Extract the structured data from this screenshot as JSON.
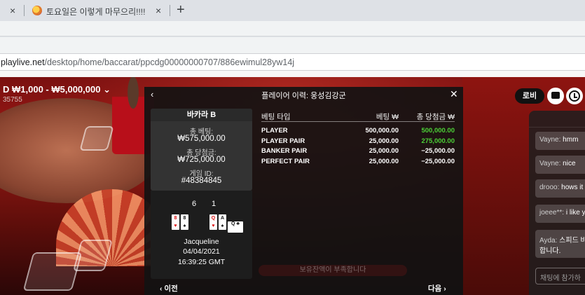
{
  "browser": {
    "tab_title": "토요일은 이렇게 마무으리!!!!",
    "close_glyph": "×",
    "new_tab_glyph": "+",
    "url_domain": "playlive.net",
    "url_path": "/desktop/home/baccarat/ppcdg00000000707/886ewimul28yw14j"
  },
  "game": {
    "title": "D ₩1,000 - ₩5,000,000",
    "subtitle": "35755",
    "lobby_label": "로비",
    "warning": "보유잔액이 부족합니다"
  },
  "chat": {
    "messages": [
      {
        "name": "Vayne:",
        "text": "hmm"
      },
      {
        "name": "Vayne:",
        "text": "nice"
      },
      {
        "name": "drooo:",
        "text": "hows it"
      },
      {
        "name": "joeee**:",
        "text": "i like yo"
      },
      {
        "name": "Ayda:",
        "text": "스피드 바 합니다."
      }
    ],
    "input_placeholder": "채팅에 참가하"
  },
  "history": {
    "title": "플레이어 이력: 웅성김강군",
    "game_name": "바카라 B",
    "total_bet_label": "총 베팅:",
    "total_bet_value": "₩575,000.00",
    "total_win_label": "총 당첨금:",
    "total_win_value": "₩725,000.00",
    "game_id_label": "게임 ID:",
    "game_id_value": "#48384845",
    "player_score": "6",
    "banker_score": "1",
    "cards": {
      "player": [
        {
          "rank": "8",
          "suit": "♥"
        },
        {
          "rank": "8",
          "suit": "♠"
        }
      ],
      "banker": [
        {
          "rank": "Q",
          "suit": "♥"
        },
        {
          "rank": "A",
          "suit": "♠"
        }
      ],
      "banker_side": {
        "rank": "Q",
        "suit": "♣"
      }
    },
    "dealer": "Jacqueline",
    "date": "04/04/2021",
    "time": "16:39:25 GMT",
    "columns": [
      "베팅 타입",
      "베팅 ₩",
      "총 당첨금 ₩"
    ],
    "rows": [
      {
        "type": "PLAYER",
        "bet": "500,000.00",
        "win": "500,000.00",
        "positive": true
      },
      {
        "type": "PLAYER PAIR",
        "bet": "25,000.00",
        "win": "275,000.00",
        "positive": true
      },
      {
        "type": "BANKER PAIR",
        "bet": "25,000.00",
        "win": "−25,000.00",
        "positive": false
      },
      {
        "type": "PERFECT PAIR",
        "bet": "25,000.00",
        "win": "−25,000.00",
        "positive": false
      }
    ],
    "prev_label": "이전",
    "next_label": "다음"
  }
}
